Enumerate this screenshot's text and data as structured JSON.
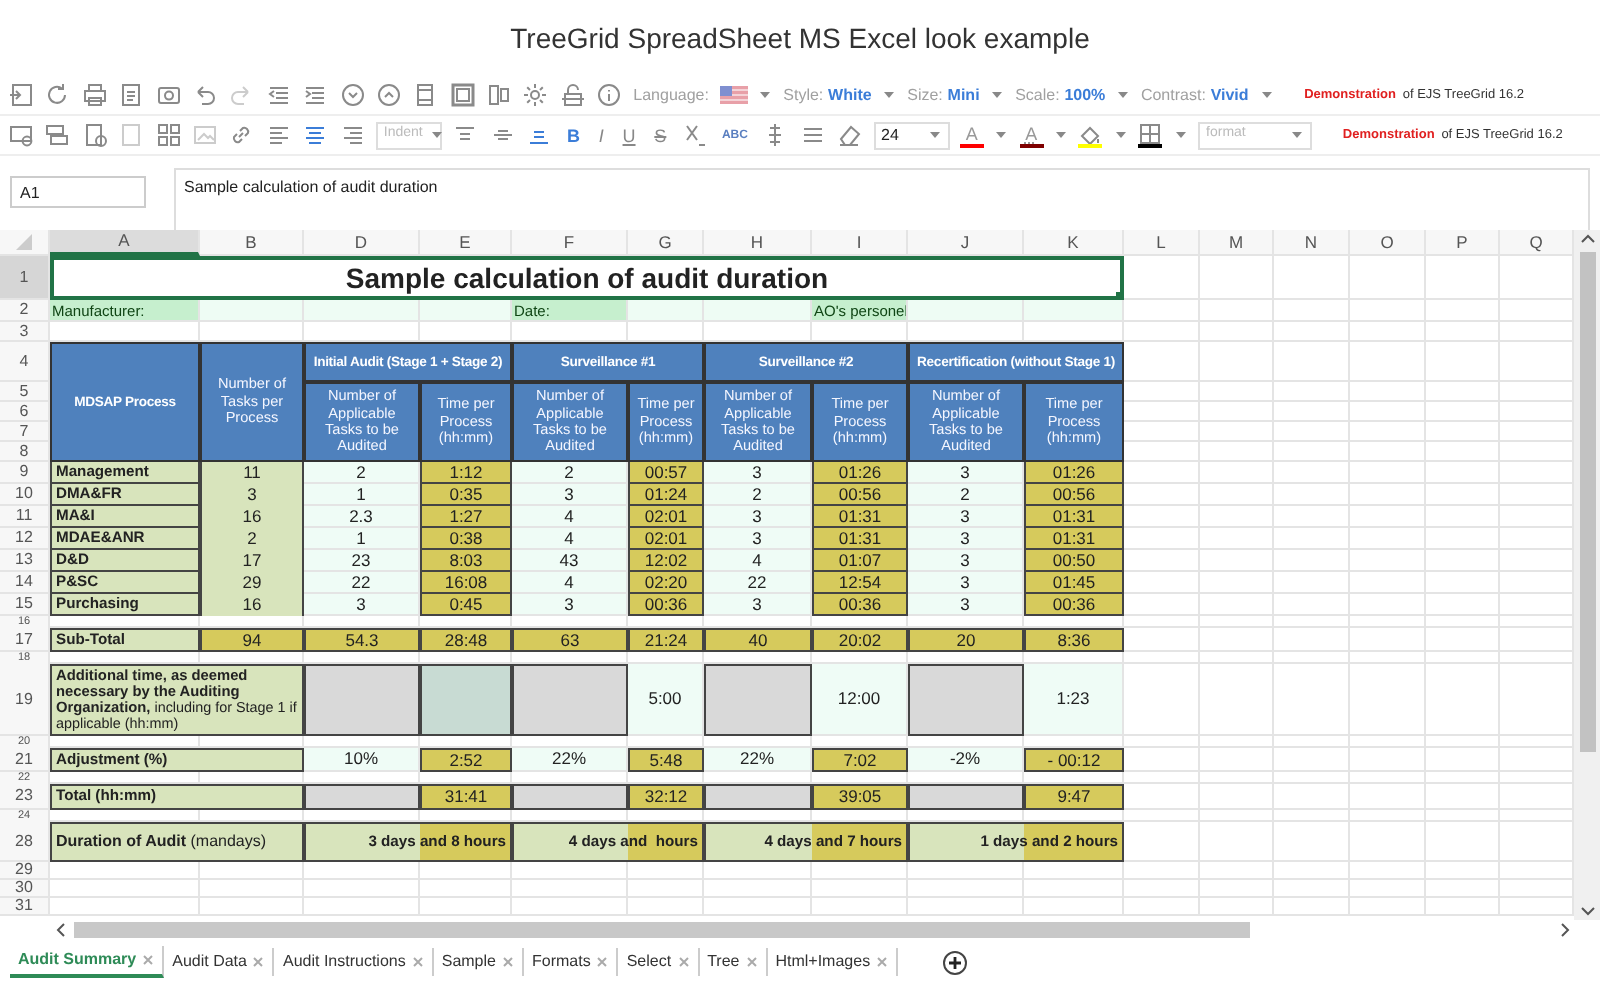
{
  "page_title": "TreeGrid SpreadSheet MS Excel look example",
  "toolbar": {
    "settings": [
      {
        "label": "Language:",
        "kind": "flag"
      },
      {
        "label": "Style:",
        "value": "White",
        "kind": "choice"
      },
      {
        "label": "Size:",
        "value": "Mini",
        "kind": "choice"
      },
      {
        "label": "Scale:",
        "value": "100%",
        "kind": "choice"
      },
      {
        "label": "Contrast:",
        "value": "Vivid",
        "kind": "choice"
      }
    ],
    "demo": {
      "label": "Demonstration",
      "text": "of EJS TreeGrid 16.2"
    }
  },
  "format_bar": {
    "indent_placeholder": "Indent",
    "text_buttons": [
      {
        "text": "B",
        "kind": "bold"
      },
      {
        "text": "I",
        "kind": "italic"
      },
      {
        "text": "U",
        "kind": "underline"
      },
      {
        "text": "S",
        "kind": "strike"
      }
    ],
    "spell": "ABC",
    "font_size": "24",
    "color_buttons": [
      {
        "kind": "text",
        "glyph": "A",
        "color": "#ff0000"
      },
      {
        "kind": "back",
        "glyph": "A",
        "color": "#7f0000"
      },
      {
        "kind": "fill",
        "color": "#ffff00"
      },
      {
        "kind": "border",
        "color": "#000000"
      }
    ],
    "format_placeholder": "format",
    "demo": {
      "label": "Demonstration",
      "text": "of EJS TreeGrid 16.2"
    }
  },
  "formula_bar": {
    "cell": "A1",
    "formula": "Sample calculation of audit duration"
  },
  "sheet": {
    "columns": [
      {
        "label": "A",
        "selected": true
      },
      {
        "label": "B",
        "selected": false
      },
      {
        "label": "D",
        "selected": false
      },
      {
        "label": "E",
        "selected": false
      },
      {
        "label": "F",
        "selected": false
      },
      {
        "label": "G",
        "selected": false
      },
      {
        "label": "H",
        "selected": false
      },
      {
        "label": "I",
        "selected": false
      },
      {
        "label": "J",
        "selected": false
      },
      {
        "label": "K",
        "selected": false
      },
      {
        "label": "L",
        "selected": false
      },
      {
        "label": "M",
        "selected": false
      },
      {
        "label": "N",
        "selected": false
      },
      {
        "label": "O",
        "selected": false
      },
      {
        "label": "P",
        "selected": false
      },
      {
        "label": "Q",
        "selected": false
      }
    ],
    "rows": [
      {
        "number": "1",
        "kind": "title",
        "selected": true,
        "cells": [
          {
            "text": "Sample calculation of audit duration",
            "kind": "title",
            "colspan": 10
          }
        ]
      },
      {
        "number": "2",
        "kind": "field",
        "selected": false,
        "cells": [
          {
            "text": "Manufacturer:",
            "kind": "label"
          },
          {
            "kind": "field"
          },
          {
            "kind": "field"
          },
          {
            "kind": "field"
          },
          {
            "text": "Date:",
            "kind": "label"
          },
          {
            "kind": "field"
          },
          {
            "kind": "field"
          },
          {
            "text": "AO's personel",
            "kind": "label"
          },
          {
            "kind": "field"
          },
          {
            "kind": "field"
          }
        ]
      },
      {
        "number": "3",
        "kind": "blank",
        "selected": false,
        "cells": []
      },
      {
        "number": "4",
        "kind": "band",
        "selected": false,
        "cells": [
          {
            "text": "MDSAP Process",
            "kind": "caption",
            "rowspan": 5
          },
          {
            "text": "Number of Tasks per Process",
            "kind": "head",
            "rowspan": 5
          },
          {
            "text": "Initial Audit (Stage 1 + Stage 2)",
            "kind": "caption",
            "colspan": 2
          },
          {
            "text": "Surveillance #1",
            "kind": "caption",
            "colspan": 2
          },
          {
            "text": "Surveillance #2",
            "kind": "caption",
            "colspan": 2
          },
          {
            "text": "Recertification (without Stage 1)",
            "kind": "caption",
            "colspan": 2
          }
        ]
      },
      {
        "number": "5",
        "kind": "head",
        "selected": false,
        "cells": [
          {
            "text": "Number of Applicable Tasks to be Audited",
            "kind": "head",
            "rowspan": 4
          },
          {
            "text": "Time per Process (hh:mm)",
            "kind": "head",
            "rowspan": 4
          },
          {
            "text": "Number of Applicable Tasks to be Audited",
            "kind": "head",
            "rowspan": 4
          },
          {
            "text": "Time per Process (hh:mm)",
            "kind": "head",
            "rowspan": 4
          },
          {
            "text": "Number of Applicable Tasks to be Audited",
            "kind": "head",
            "rowspan": 4
          },
          {
            "text": "Time per Process (hh:mm)",
            "kind": "head",
            "rowspan": 4
          },
          {
            "text": "Number of Applicable Tasks to be Audited",
            "kind": "head",
            "rowspan": 4
          },
          {
            "text": "Time per Process (hh:mm)",
            "kind": "head",
            "rowspan": 4
          }
        ]
      },
      {
        "number": "6",
        "kind": "head",
        "selected": false,
        "cells": []
      },
      {
        "number": "7",
        "kind": "head",
        "selected": false,
        "cells": []
      },
      {
        "number": "8",
        "kind": "head",
        "selected": false,
        "cells": []
      },
      {
        "number": "9",
        "kind": "data",
        "selected": false,
        "cells": [
          {
            "text": "Management",
            "kind": "process"
          },
          {
            "text": "11",
            "kind": "count"
          },
          {
            "text": "2",
            "kind": "mint"
          },
          {
            "text": "1:12",
            "kind": "gold"
          },
          {
            "text": "2",
            "kind": "mint"
          },
          {
            "text": "00:57",
            "kind": "gold"
          },
          {
            "text": "3",
            "kind": "mint"
          },
          {
            "text": "01:26",
            "kind": "gold"
          },
          {
            "text": "3",
            "kind": "mint"
          },
          {
            "text": "01:26",
            "kind": "gold"
          }
        ]
      },
      {
        "number": "10",
        "kind": "data",
        "selected": false,
        "cells": [
          {
            "text": "DMA&FR",
            "kind": "process"
          },
          {
            "text": "3",
            "kind": "count"
          },
          {
            "text": "1",
            "kind": "mint"
          },
          {
            "text": "0:35",
            "kind": "gold"
          },
          {
            "text": "3",
            "kind": "mint"
          },
          {
            "text": "01:24",
            "kind": "gold"
          },
          {
            "text": "2",
            "kind": "mint"
          },
          {
            "text": "00:56",
            "kind": "gold"
          },
          {
            "text": "2",
            "kind": "mint"
          },
          {
            "text": "00:56",
            "kind": "gold"
          }
        ]
      },
      {
        "number": "11",
        "kind": "data",
        "selected": false,
        "cells": [
          {
            "text": "MA&I",
            "kind": "process"
          },
          {
            "text": "16",
            "kind": "count"
          },
          {
            "text": "2.3",
            "kind": "mint"
          },
          {
            "text": "1:27",
            "kind": "gold"
          },
          {
            "text": "4",
            "kind": "mint"
          },
          {
            "text": "02:01",
            "kind": "gold"
          },
          {
            "text": "3",
            "kind": "mint"
          },
          {
            "text": "01:31",
            "kind": "gold"
          },
          {
            "text": "3",
            "kind": "mint"
          },
          {
            "text": "01:31",
            "kind": "gold"
          }
        ]
      },
      {
        "number": "12",
        "kind": "data",
        "selected": false,
        "cells": [
          {
            "text": "MDAE&ANR",
            "kind": "process"
          },
          {
            "text": "2",
            "kind": "count"
          },
          {
            "text": "1",
            "kind": "mint"
          },
          {
            "text": "0:38",
            "kind": "gold"
          },
          {
            "text": "4",
            "kind": "mint"
          },
          {
            "text": "02:01",
            "kind": "gold"
          },
          {
            "text": "3",
            "kind": "mint"
          },
          {
            "text": "01:31",
            "kind": "gold"
          },
          {
            "text": "3",
            "kind": "mint"
          },
          {
            "text": "01:31",
            "kind": "gold"
          }
        ]
      },
      {
        "number": "13",
        "kind": "data",
        "selected": false,
        "cells": [
          {
            "text": "D&D",
            "kind": "process"
          },
          {
            "text": "17",
            "kind": "count"
          },
          {
            "text": "23",
            "kind": "mint"
          },
          {
            "text": "8:03",
            "kind": "gold"
          },
          {
            "text": "43",
            "kind": "mint"
          },
          {
            "text": "12:02",
            "kind": "gold"
          },
          {
            "text": "4",
            "kind": "mint"
          },
          {
            "text": "01:07",
            "kind": "gold"
          },
          {
            "text": "3",
            "kind": "mint"
          },
          {
            "text": "00:50",
            "kind": "gold"
          }
        ]
      },
      {
        "number": "14",
        "kind": "data",
        "selected": false,
        "cells": [
          {
            "text": "P&SC",
            "kind": "process"
          },
          {
            "text": "29",
            "kind": "count"
          },
          {
            "text": "22",
            "kind": "mint"
          },
          {
            "text": "16:08",
            "kind": "gold"
          },
          {
            "text": "4",
            "kind": "mint"
          },
          {
            "text": "02:20",
            "kind": "gold"
          },
          {
            "text": "22",
            "kind": "mint"
          },
          {
            "text": "12:54",
            "kind": "gold"
          },
          {
            "text": "3",
            "kind": "mint"
          },
          {
            "text": "01:45",
            "kind": "gold"
          }
        ]
      },
      {
        "number": "15",
        "kind": "data",
        "selected": false,
        "cells": [
          {
            "text": "Purchasing",
            "kind": "process"
          },
          {
            "text": "16",
            "kind": "count"
          },
          {
            "text": "3",
            "kind": "mint"
          },
          {
            "text": "0:45",
            "kind": "gold"
          },
          {
            "text": "3",
            "kind": "mint"
          },
          {
            "text": "00:36",
            "kind": "gold"
          },
          {
            "text": "3",
            "kind": "mint"
          },
          {
            "text": "00:36",
            "kind": "gold"
          },
          {
            "text": "3",
            "kind": "mint"
          },
          {
            "text": "00:36",
            "kind": "gold"
          }
        ]
      },
      {
        "number": "16",
        "kind": "gap",
        "selected": false,
        "cells": []
      },
      {
        "number": "17",
        "kind": "sum",
        "selected": false,
        "cells": [
          {
            "text": "Sub-Total",
            "kind": "process"
          },
          {
            "text": "94",
            "kind": "gold"
          },
          {
            "text": "54.3",
            "kind": "gold"
          },
          {
            "text": "28:48",
            "kind": "gold"
          },
          {
            "text": "63",
            "kind": "gold"
          },
          {
            "text": "21:24",
            "kind": "gold"
          },
          {
            "text": "40",
            "kind": "gold"
          },
          {
            "text": "20:02",
            "kind": "gold"
          },
          {
            "text": "20",
            "kind": "gold"
          },
          {
            "text": "8:36",
            "kind": "gold"
          }
        ]
      },
      {
        "number": "18",
        "kind": "gap",
        "selected": false,
        "cells": []
      },
      {
        "number": "19",
        "kind": "note",
        "selected": false,
        "cells": [
          {
            "text": "**Additional time, as deemed necessary by the Auditing Organization,** including for Stage 1 if applicable (hh:mm)",
            "kind": "note",
            "colspan": 2
          },
          {
            "kind": "gray"
          },
          {
            "kind": "ashen"
          },
          {
            "kind": "gray"
          },
          {
            "text": "5:00",
            "kind": "mint"
          },
          {
            "kind": "gray"
          },
          {
            "text": "12:00",
            "kind": "mint"
          },
          {
            "kind": "gray"
          },
          {
            "text": "1:23",
            "kind": "mint"
          }
        ]
      },
      {
        "number": "20",
        "kind": "gap",
        "selected": false,
        "cells": []
      },
      {
        "number": "21",
        "kind": "sum",
        "selected": false,
        "cells": [
          {
            "text": "Adjustment (%)",
            "kind": "process",
            "colspan": 2
          },
          {
            "text": "10%",
            "kind": "mint"
          },
          {
            "text": "2:52",
            "kind": "gold"
          },
          {
            "text": "22%",
            "kind": "mint"
          },
          {
            "text": "5:48",
            "kind": "gold"
          },
          {
            "text": "22%",
            "kind": "mint"
          },
          {
            "text": "7:02",
            "kind": "gold"
          },
          {
            "text": "-2%",
            "kind": "mint"
          },
          {
            "text": "- 00:12",
            "kind": "gold"
          }
        ]
      },
      {
        "number": "22",
        "kind": "gap",
        "selected": false,
        "cells": []
      },
      {
        "number": "23",
        "kind": "total",
        "selected": false,
        "cells": [
          {
            "text": "Total (hh:mm)",
            "kind": "process",
            "colspan": 2
          },
          {
            "kind": "gray"
          },
          {
            "text": "31:41",
            "kind": "gold"
          },
          {
            "kind": "gray"
          },
          {
            "text": "32:12",
            "kind": "gold"
          },
          {
            "kind": "gray"
          },
          {
            "text": "39:05",
            "kind": "gold"
          },
          {
            "kind": "gray"
          },
          {
            "text": "9:47",
            "kind": "gold"
          }
        ]
      },
      {
        "number": "24",
        "kind": "gap",
        "selected": false,
        "cells": []
      },
      {
        "number": "28",
        "kind": "duration",
        "selected": false,
        "cells": [
          {
            "text": "**Duration of Audit** (mandays)",
            "kind": "heading",
            "colspan": 2
          },
          {
            "text": "3 days and 8 hours",
            "kind": "split",
            "colspan": 2
          },
          {
            "text": "4 days and  hours",
            "kind": "split",
            "colspan": 2
          },
          {
            "text": "4 days and 7 hours",
            "kind": "split",
            "colspan": 2
          },
          {
            "text": "1 days and 2 hours",
            "kind": "split",
            "colspan": 2
          }
        ]
      },
      {
        "number": "29",
        "kind": "empty",
        "selected": false,
        "cells": []
      },
      {
        "number": "30",
        "kind": "empty",
        "selected": false,
        "cells": []
      },
      {
        "number": "31",
        "kind": "empty",
        "selected": false,
        "cells": []
      }
    ]
  },
  "tabs": [
    {
      "label": "Audit Summary",
      "selected": true
    },
    {
      "label": "Audit Data",
      "selected": false
    },
    {
      "label": "Audit Instructions",
      "selected": false
    },
    {
      "label": "Sample",
      "selected": false
    },
    {
      "label": "Formats",
      "selected": false
    },
    {
      "label": "Select",
      "selected": false
    },
    {
      "label": "Tree",
      "selected": false
    },
    {
      "label": "Html+Images",
      "selected": false
    }
  ]
}
